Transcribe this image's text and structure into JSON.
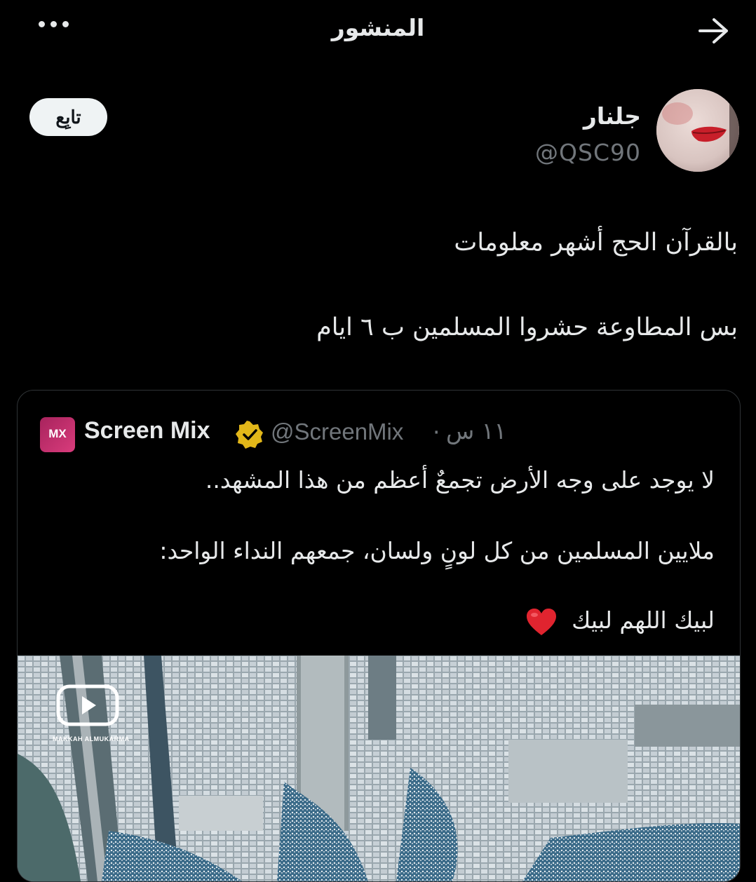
{
  "header": {
    "title": "المنشور",
    "more_icon": "more-horizontal-icon",
    "back_icon": "arrow-right-icon"
  },
  "author": {
    "name": "جلنار",
    "handle": "@QSC90",
    "follow_label": "تابِع"
  },
  "post": {
    "lines": [
      "بالقرآن الحج أشهر معلومات",
      "بس المطاوعة حشروا المسلمين ب ٦ ايام"
    ]
  },
  "quote": {
    "name": "Screen Mix",
    "handle": "@ScreenMix",
    "separator": "·",
    "time": "١١ س",
    "lines": [
      "لا يوجد على وجه الأرض تجمعٌ أعظم من هذا المشهد..",
      "ملايين المسلمين من كل لونٍ ولسان، جمعهم النداء الواحد:",
      "لبيك اللهم لبيك"
    ],
    "logo_text": "MX",
    "media_watermark": "MAKKAH ALMUKARMA"
  },
  "colors": {
    "background": "#000000",
    "text": "#e7e9ea",
    "secondary": "#71767b",
    "border": "#2f3336",
    "verified": "#e2b719",
    "heart": "#e0242f"
  }
}
